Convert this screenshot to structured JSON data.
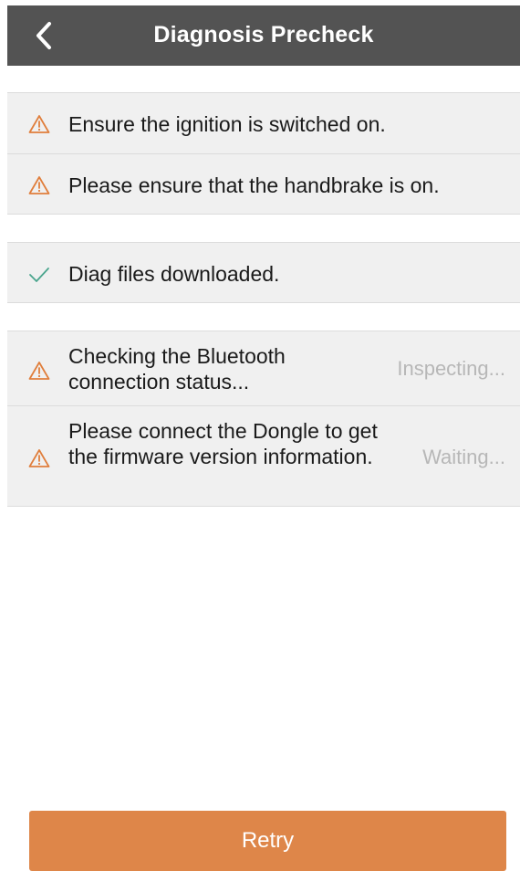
{
  "header": {
    "title": "Diagnosis Precheck",
    "back_icon": "chevron-left-icon"
  },
  "colors": {
    "header_bg": "#535353",
    "row_bg": "#f0f0f0",
    "warning": "#e07e3c",
    "success": "#4aa58d",
    "status_text": "#b7b7b7",
    "button_bg": "#de8649"
  },
  "groups": [
    {
      "items": [
        {
          "icon": "warning-icon",
          "text": "Ensure the ignition is switched on.",
          "status": ""
        },
        {
          "icon": "warning-icon",
          "text": "Please ensure that the handbrake is on.",
          "status": ""
        }
      ]
    },
    {
      "items": [
        {
          "icon": "check-icon",
          "text": "Diag files downloaded.",
          "status": ""
        }
      ]
    },
    {
      "items": [
        {
          "icon": "warning-icon",
          "text": "Checking the Bluetooth connection status...",
          "status": "Inspecting..."
        },
        {
          "icon": "warning-icon",
          "text": "Please connect the Dongle to get the firmware version information.",
          "status": "Waiting..."
        }
      ]
    }
  ],
  "retry_button": {
    "label": "Retry"
  }
}
